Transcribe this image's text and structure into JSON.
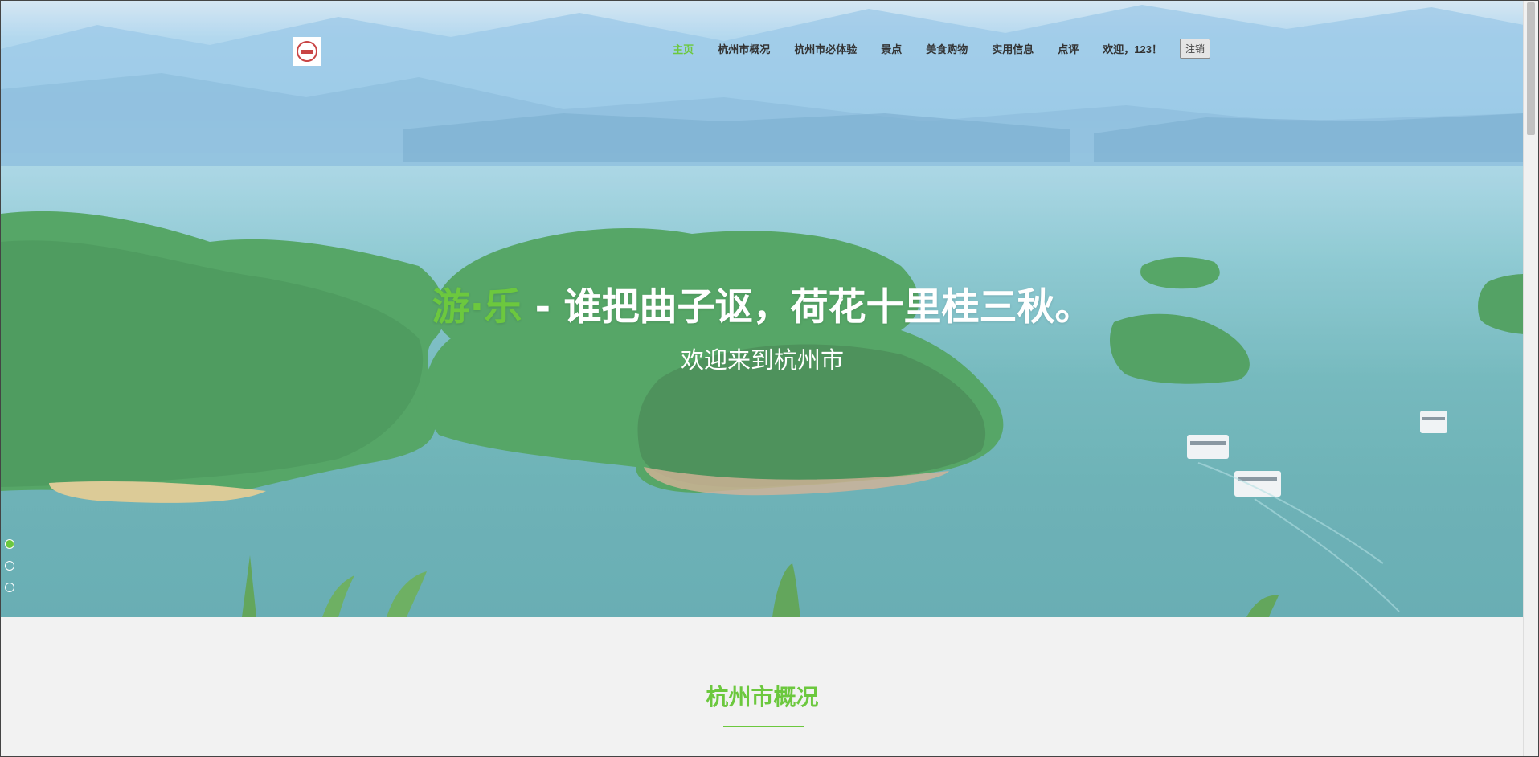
{
  "nav": {
    "items": [
      {
        "label": "主页",
        "active": true
      },
      {
        "label": "杭州市概况"
      },
      {
        "label": "杭州市必体验"
      },
      {
        "label": "景点"
      },
      {
        "label": "美食购物"
      },
      {
        "label": "实用信息"
      },
      {
        "label": "点评"
      }
    ],
    "welcome": "欢迎，123！",
    "logout_label": "注销"
  },
  "hero": {
    "headline_accent": "游·乐",
    "headline_rest": " - 谁把曲子讴，荷花十里桂三秋。",
    "subheading": "欢迎来到杭州市",
    "slides": [
      {
        "active": true
      },
      {
        "active": false
      },
      {
        "active": false
      }
    ]
  },
  "section": {
    "title": "杭州市概况"
  },
  "colors": {
    "accent": "#6cc83e",
    "nav_text": "#333333",
    "page_background": "#f2f2f2"
  }
}
